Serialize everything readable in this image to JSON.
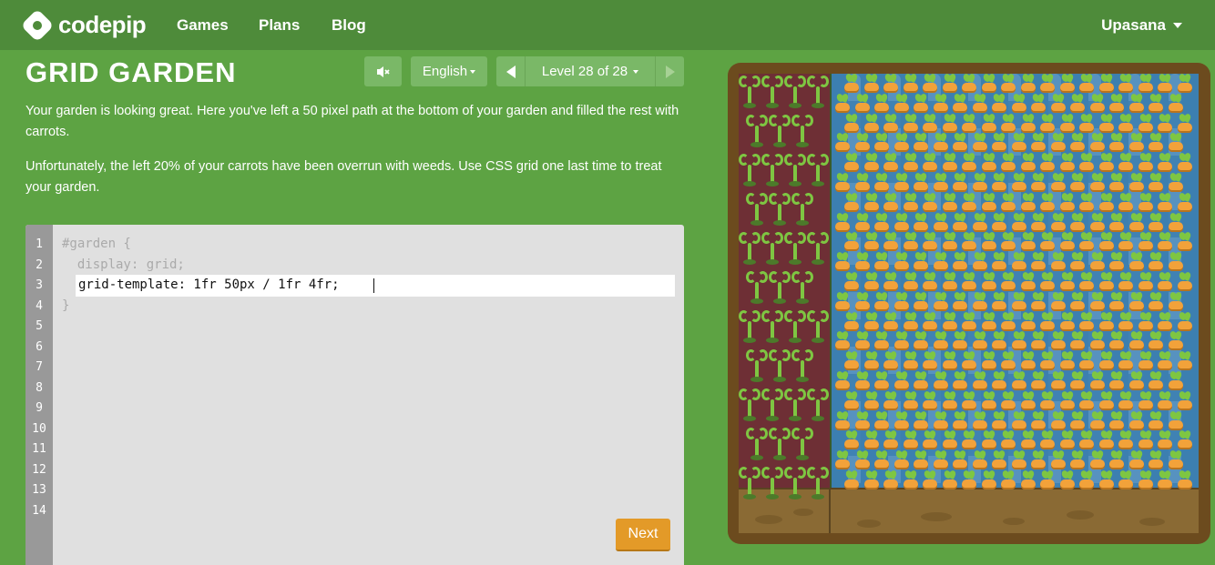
{
  "nav": {
    "brand": "codepip",
    "links": [
      "Games",
      "Plans",
      "Blog"
    ],
    "user": "Upasana"
  },
  "game": {
    "title": "GRID GARDEN",
    "language": "English",
    "level_label": "Level 28 of 28",
    "instructions": [
      "Your garden is looking great. Here you've left a 50 pixel path at the bottom of your garden and filled the rest with carrots.",
      "Unfortunately, the left 20% of your carrots have been overrun with weeds. Use CSS grid one last time to treat your garden."
    ]
  },
  "editor": {
    "line_numbers": [
      "1",
      "2",
      "3",
      "4",
      "5",
      "6",
      "7",
      "8",
      "9",
      "10",
      "11",
      "12",
      "13",
      "14"
    ],
    "line1": "#garden {",
    "line2": "  display: grid;",
    "input_value": "grid-template: 1fr 50px / 1fr 4fr;",
    "line4": "}",
    "next_label": "Next"
  },
  "colors": {
    "background": "#5da343",
    "topbar": "#4e8b3a",
    "accent_button": "#e39a28",
    "water": "#3c7fb0",
    "weeds": "#6e2f35",
    "path": "#8a6a34"
  },
  "icons": {
    "mute": "mute-icon",
    "prev": "prev-level-icon",
    "next": "next-level-icon"
  }
}
